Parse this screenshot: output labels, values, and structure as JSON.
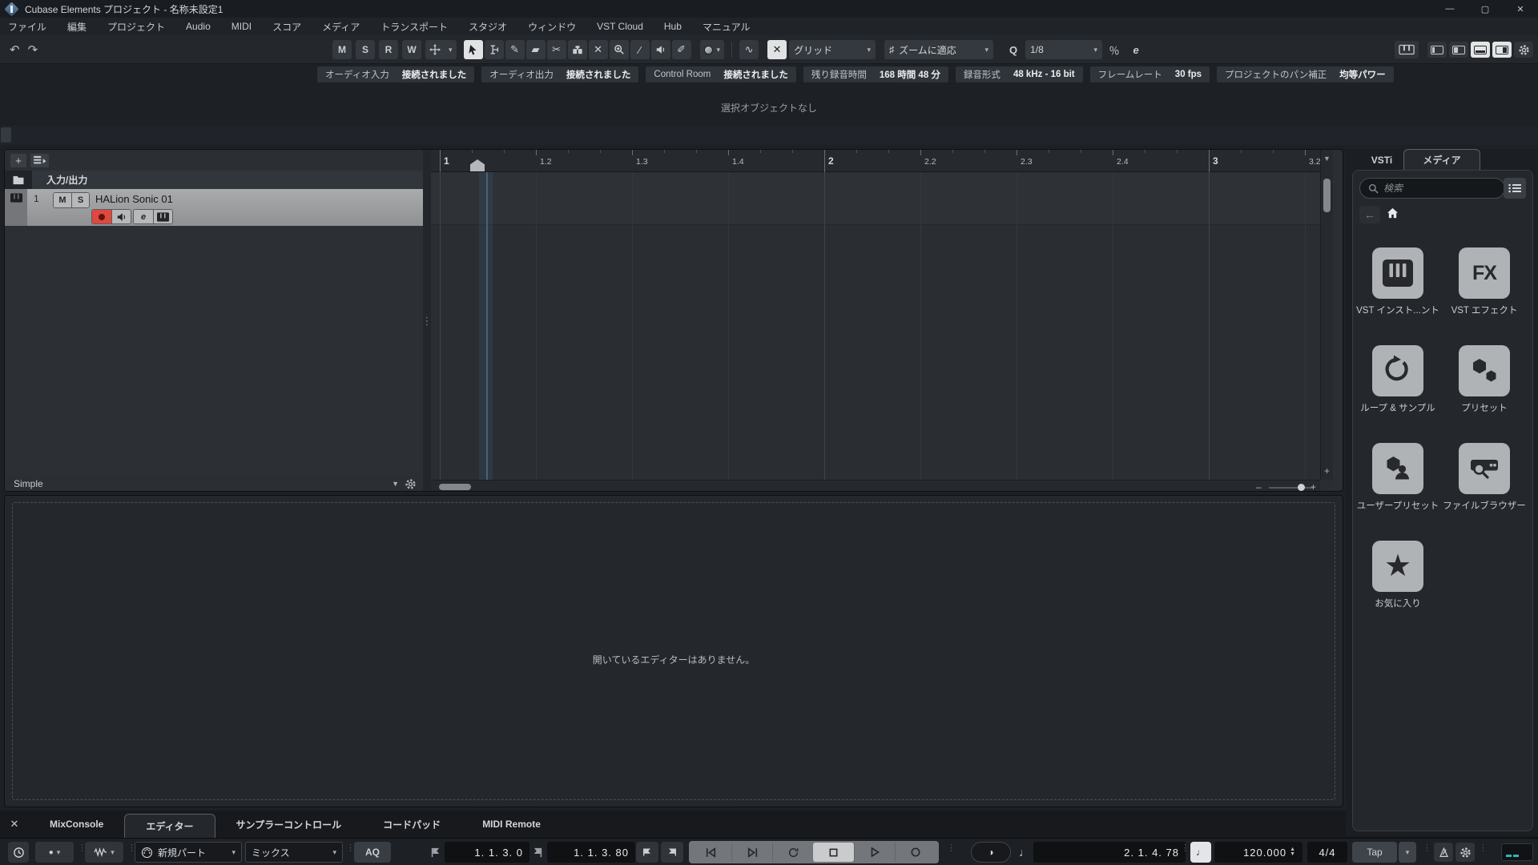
{
  "titlebar": {
    "title": "Cubase Elements プロジェクト - 名称未設定1"
  },
  "menubar": [
    "ファイル",
    "編集",
    "プロジェクト",
    "Audio",
    "MIDI",
    "スコア",
    "メディア",
    "トランスポート",
    "スタジオ",
    "ウィンドウ",
    "VST Cloud",
    "Hub",
    "マニュアル"
  ],
  "toolbar": {
    "automation": [
      "M",
      "S",
      "R",
      "W"
    ],
    "grid_field": "グリッド",
    "zoom_field": "ズームに適応",
    "quantize_field": "1/8",
    "quantize_letter": "Q",
    "edit_letter": "e"
  },
  "info_bar": [
    {
      "label": "オーディオ入力",
      "value": "接続されました"
    },
    {
      "label": "オーディオ出力",
      "value": "接続されました"
    },
    {
      "label": "Control Room",
      "value": "接続されました"
    },
    {
      "label": "残り録音時間",
      "value": "168 時間 48 分"
    },
    {
      "label": "録音形式",
      "value": "48 kHz - 16 bit"
    },
    {
      "label": "フレームレート",
      "value": "30 fps"
    },
    {
      "label": "プロジェクトのパン補正",
      "value": "均等パワー"
    }
  ],
  "status_line": "選択オブジェクトなし",
  "track_list": {
    "io_folder": "入力/出力",
    "track": {
      "number": "1",
      "mute": "M",
      "solo": "S",
      "name": "HALion Sonic 01",
      "edit": "e"
    },
    "height_preset": "Simple"
  },
  "ruler": {
    "ticks": [
      "1",
      "1.2",
      "1.3",
      "1.4",
      "2",
      "2.2",
      "2.3",
      "2.4",
      "3",
      "3.2"
    ]
  },
  "lower_zone": {
    "tabs": [
      {
        "label": "MixConsole",
        "active": false
      },
      {
        "label": "エディター",
        "active": true
      },
      {
        "label": "サンプラーコントロール",
        "active": false
      },
      {
        "label": "コードパッド",
        "active": false
      },
      {
        "label": "MIDI Remote",
        "active": false
      }
    ],
    "empty_message": "開いているエディターはありません。"
  },
  "right_zone": {
    "tabs": [
      {
        "label": "VSTi",
        "active": false
      },
      {
        "label": "メディア",
        "active": true
      }
    ],
    "search_placeholder": "検索",
    "tiles": [
      {
        "label": "VST インスト...ント",
        "icon": "piano-icon"
      },
      {
        "label": "VST エフェクト",
        "icon": "fx-icon"
      },
      {
        "label": "ループ & サンプル",
        "icon": "loop-icon"
      },
      {
        "label": "プリセット",
        "icon": "hexagons-icon"
      },
      {
        "label": "ユーザープリセット",
        "icon": "user-preset-icon"
      },
      {
        "label": "ファイルブラウザー",
        "icon": "file-browser-icon"
      },
      {
        "label": "お気に入り",
        "icon": "star-icon"
      }
    ]
  },
  "transport": {
    "new_part": "新規パート",
    "mix_mode": "ミックス",
    "auto_q": "AQ",
    "left_locator": "1. 1. 3. 0",
    "right_locator": "1. 1. 3. 80",
    "position": "2. 1. 4. 78",
    "tempo": "120.000",
    "time_signature": "4/4",
    "tap": "Tap"
  },
  "colors": {
    "accent_teal": "#2fb3bf",
    "record_red": "#e0483e",
    "selected_track_gray": "#a9abad",
    "active_button": "#e0e2e4"
  }
}
